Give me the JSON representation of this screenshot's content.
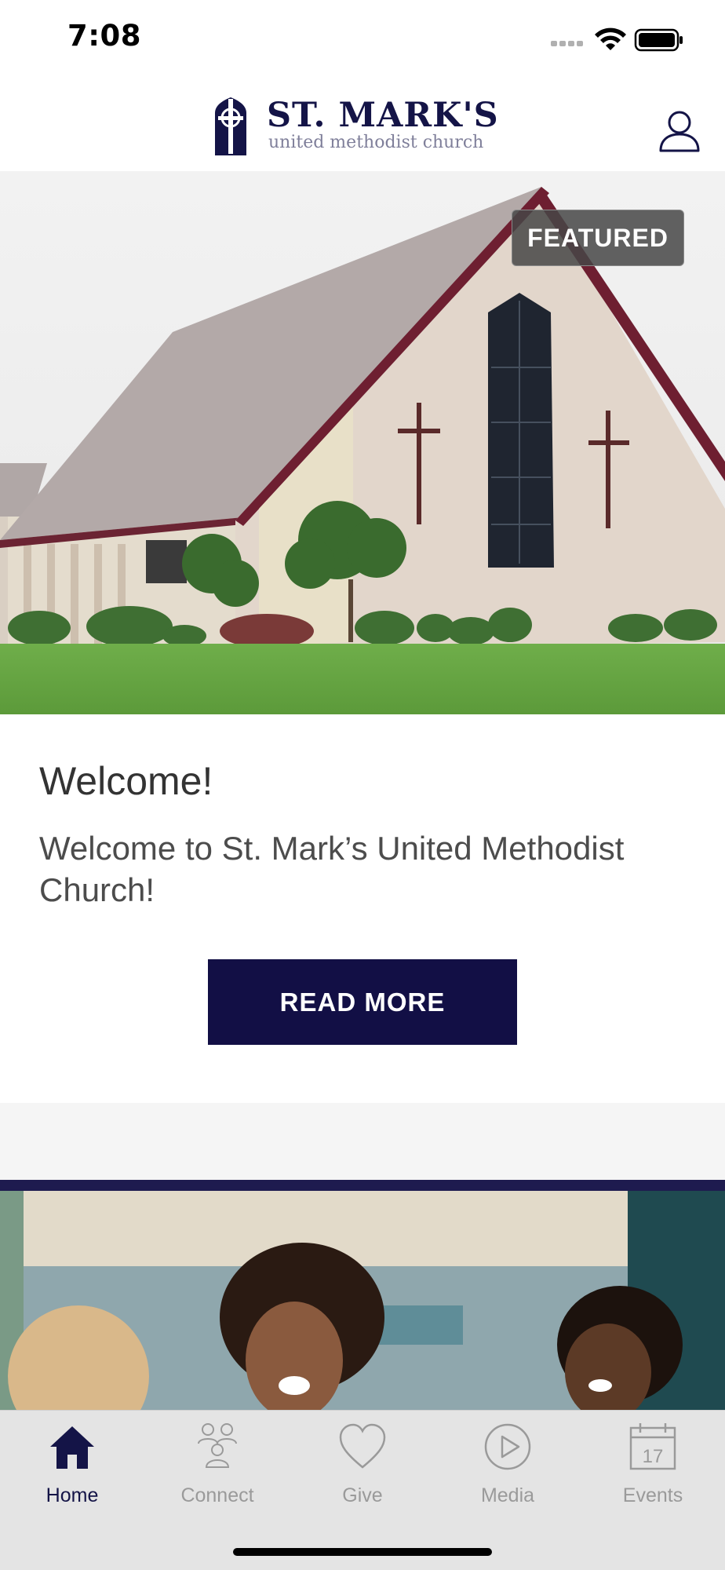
{
  "status_bar": {
    "time": "7:08",
    "signal_icon": "signal-dots-icon",
    "wifi_icon": "wifi-icon",
    "battery_icon": "battery-icon"
  },
  "header": {
    "logo_title": "ST. MARK'S",
    "logo_subtitle": "united methodist church",
    "logo_icon": "cross-shield-icon",
    "profile_icon": "user-icon",
    "brand_color": "#141447"
  },
  "featured_card": {
    "badge": "FEATURED",
    "image": "church-building-photo",
    "title": "Welcome!",
    "text": "Welcome to St. Mark’s United Methodist Church!",
    "button_label": "READ MORE"
  },
  "second_card": {
    "image": "people-smiling-photo"
  },
  "tab_bar": {
    "tabs": [
      {
        "label": "Home",
        "icon": "home-icon",
        "active": true
      },
      {
        "label": "Connect",
        "icon": "people-icon",
        "active": false
      },
      {
        "label": "Give",
        "icon": "heart-icon",
        "active": false
      },
      {
        "label": "Media",
        "icon": "play-circle-icon",
        "active": false
      },
      {
        "label": "Events",
        "icon": "calendar-icon",
        "active": false,
        "icon_text": "17"
      }
    ]
  }
}
